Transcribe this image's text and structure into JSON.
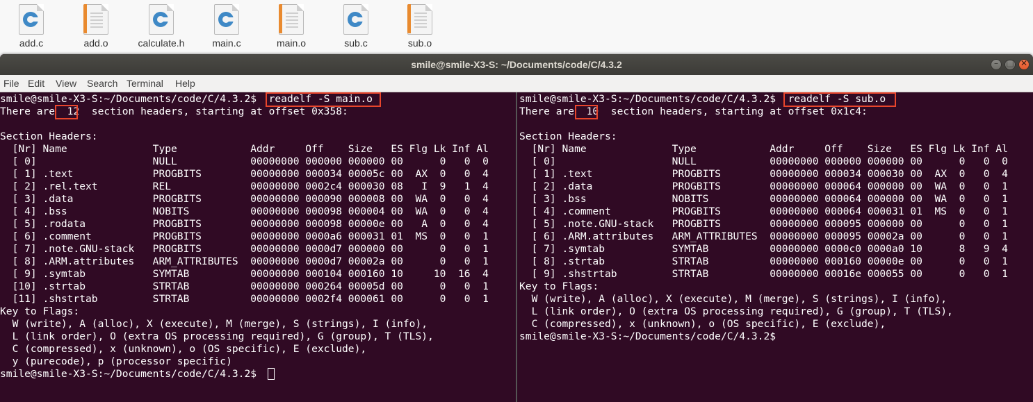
{
  "desktop": {
    "files": [
      {
        "name": "add.c",
        "type": "c-source"
      },
      {
        "name": "add.o",
        "type": "object"
      },
      {
        "name": "calculate.h",
        "type": "c-source"
      },
      {
        "name": "main.c",
        "type": "c-source"
      },
      {
        "name": "main.o",
        "type": "object"
      },
      {
        "name": "sub.c",
        "type": "c-source"
      },
      {
        "name": "sub.o",
        "type": "object"
      }
    ]
  },
  "window": {
    "title": "smile@smile-X3-S: ~/Documents/code/C/4.3.2",
    "buttons": {
      "minimize": "–",
      "maximize": "□",
      "close": "✕"
    },
    "menu": [
      "File",
      "Edit",
      "View",
      "Search",
      "Terminal",
      "Help"
    ],
    "highlight_color": "#e8452c",
    "background": "#300a24"
  },
  "left_pane": {
    "lines": [
      "smile@smile-X3-S:~/Documents/code/C/4.3.2$  readelf -S main.o",
      "There are  12  section headers, starting at offset 0x358:",
      "",
      "Section Headers:",
      "  [Nr] Name              Type            Addr     Off    Size   ES Flg Lk Inf Al",
      "  [ 0]                   NULL            00000000 000000 000000 00      0   0  0",
      "  [ 1] .text             PROGBITS        00000000 000034 00005c 00  AX  0   0  4",
      "  [ 2] .rel.text         REL             00000000 0002c4 000030 08   I  9   1  4",
      "  [ 3] .data             PROGBITS        00000000 000090 000008 00  WA  0   0  4",
      "  [ 4] .bss              NOBITS          00000000 000098 000004 00  WA  0   0  4",
      "  [ 5] .rodata           PROGBITS        00000000 000098 00000e 00   A  0   0  4",
      "  [ 6] .comment          PROGBITS        00000000 0000a6 000031 01  MS  0   0  1",
      "  [ 7] .note.GNU-stack   PROGBITS        00000000 0000d7 000000 00      0   0  1",
      "  [ 8] .ARM.attributes   ARM_ATTRIBUTES  00000000 0000d7 00002a 00      0   0  1",
      "  [ 9] .symtab           SYMTAB          00000000 000104 000160 10     10  16  4",
      "  [10] .strtab           STRTAB          00000000 000264 00005d 00      0   0  1",
      "  [11] .shstrtab         STRTAB          00000000 0002f4 000061 00      0   0  1",
      "Key to Flags:",
      "  W (write), A (alloc), X (execute), M (merge), S (strings), I (info),",
      "  L (link order), O (extra OS processing required), G (group), T (TLS),",
      "  C (compressed), x (unknown), o (OS specific), E (exclude),",
      "  y (purecode), p (processor specific)",
      "smile@smile-X3-S:~/Documents/code/C/4.3.2$ "
    ],
    "highlighted_command": "readelf -S main.o",
    "highlighted_count": "12"
  },
  "right_pane": {
    "lines": [
      "smile@smile-X3-S:~/Documents/code/C/4.3.2$  readelf -S sub.o",
      "There are  10  section headers, starting at offset 0x1c4:",
      "",
      "Section Headers:",
      "  [Nr] Name              Type            Addr     Off    Size   ES Flg Lk Inf Al",
      "  [ 0]                   NULL            00000000 000000 000000 00      0   0  0",
      "  [ 1] .text             PROGBITS        00000000 000034 000030 00  AX  0   0  4",
      "  [ 2] .data             PROGBITS        00000000 000064 000000 00  WA  0   0  1",
      "  [ 3] .bss              NOBITS          00000000 000064 000000 00  WA  0   0  1",
      "  [ 4] .comment          PROGBITS        00000000 000064 000031 01  MS  0   0  1",
      "  [ 5] .note.GNU-stack   PROGBITS        00000000 000095 000000 00      0   0  1",
      "  [ 6] .ARM.attributes   ARM_ATTRIBUTES  00000000 000095 00002a 00      0   0  1",
      "  [ 7] .symtab           SYMTAB          00000000 0000c0 0000a0 10      8   9  4",
      "  [ 8] .strtab           STRTAB          00000000 000160 00000e 00      0   0  1",
      "  [ 9] .shstrtab         STRTAB          00000000 00016e 000055 00      0   0  1",
      "Key to Flags:",
      "  W (write), A (alloc), X (execute), M (merge), S (strings), I (info),",
      "  L (link order), O (extra OS processing required), G (group), T (TLS),",
      "  C (compressed), x (unknown), o (OS specific), E (exclude),",
      "smile@smile-X3-S:~/Documents/code/C/4.3.2$"
    ],
    "highlighted_command": "readelf -S sub.o",
    "highlighted_count": "10"
  }
}
